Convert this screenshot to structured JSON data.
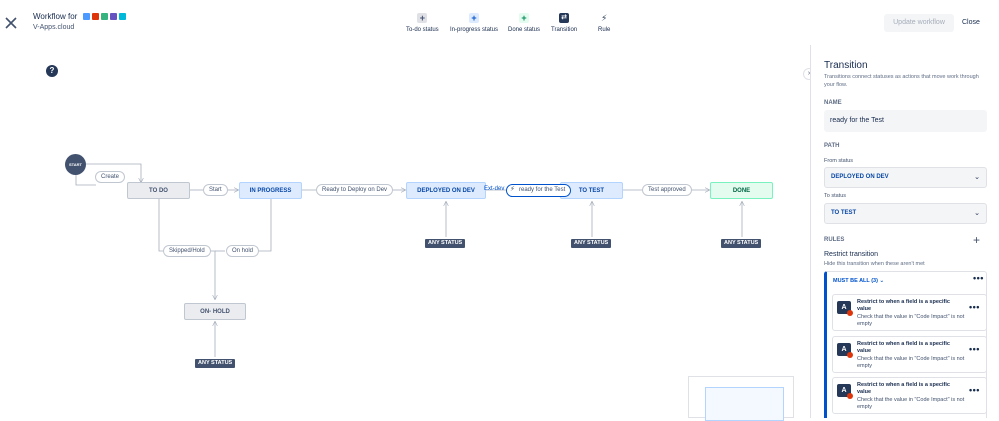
{
  "header": {
    "title": "Workflow for",
    "subtitle": "V-Apps.cloud",
    "app_icon_colors": [
      "#4c9aff",
      "#de350b",
      "#36b37e",
      "#6554c0",
      "#00b8d9"
    ],
    "tools": [
      {
        "label": "To-do status",
        "icon": "plus-icon",
        "color": "#42526e"
      },
      {
        "label": "In-progress status",
        "icon": "plus-icon",
        "color": "#0052cc"
      },
      {
        "label": "Done status",
        "icon": "plus-icon",
        "color": "#00875a"
      },
      {
        "label": "Transition",
        "icon": "transition-icon",
        "color": "#253858"
      },
      {
        "label": "Rule",
        "icon": "bolt-icon",
        "color": "#253858"
      }
    ],
    "update_label": "Update workflow",
    "close_label": "Close"
  },
  "canvas": {
    "start_label": "START",
    "nodes": {
      "todo": "TO DO",
      "inprogress": "IN PROGRESS",
      "deployed": "DEPLOYED ON DEV",
      "totest": "TO TEST",
      "done": "DONE",
      "onhold": "ON- HOLD"
    },
    "transitions": {
      "create": "Create",
      "start": "Start",
      "ready_deploy": "Ready to Deploy on Dev",
      "ready_test": "ready for the Test",
      "ghost": "Ext-dev",
      "test_approved": "Test approved",
      "skipped_hold": "Skipped/Hold",
      "on_hold": "On hold"
    },
    "any_status": "ANY STATUS"
  },
  "panel": {
    "title": "Transition",
    "description": "Transitions connect statuses as actions that move work through your flow.",
    "name_label": "NAME",
    "name_value": "ready for the Test",
    "path_label": "PATH",
    "from_label": "From status",
    "from_value": "DEPLOYED ON DEV",
    "to_label": "To status",
    "to_value": "TO TEST",
    "rules_label": "RULES",
    "restrict_title": "Restrict transition",
    "restrict_sub": "Hide this transition when these aren't met",
    "must_be_all": "MUST BE ALL (3)",
    "rules": [
      {
        "title": "Restrict to when a field is a specific value",
        "desc": "Check that the value in \"Code Impact\" is not empty"
      },
      {
        "title": "Restrict to when a field is a specific value",
        "desc": "Check that the value in \"Code Impact\" is not empty"
      },
      {
        "title": "Restrict to when a field is a specific value",
        "desc": "Check that the value in \"Code Impact\" is not empty"
      }
    ]
  }
}
